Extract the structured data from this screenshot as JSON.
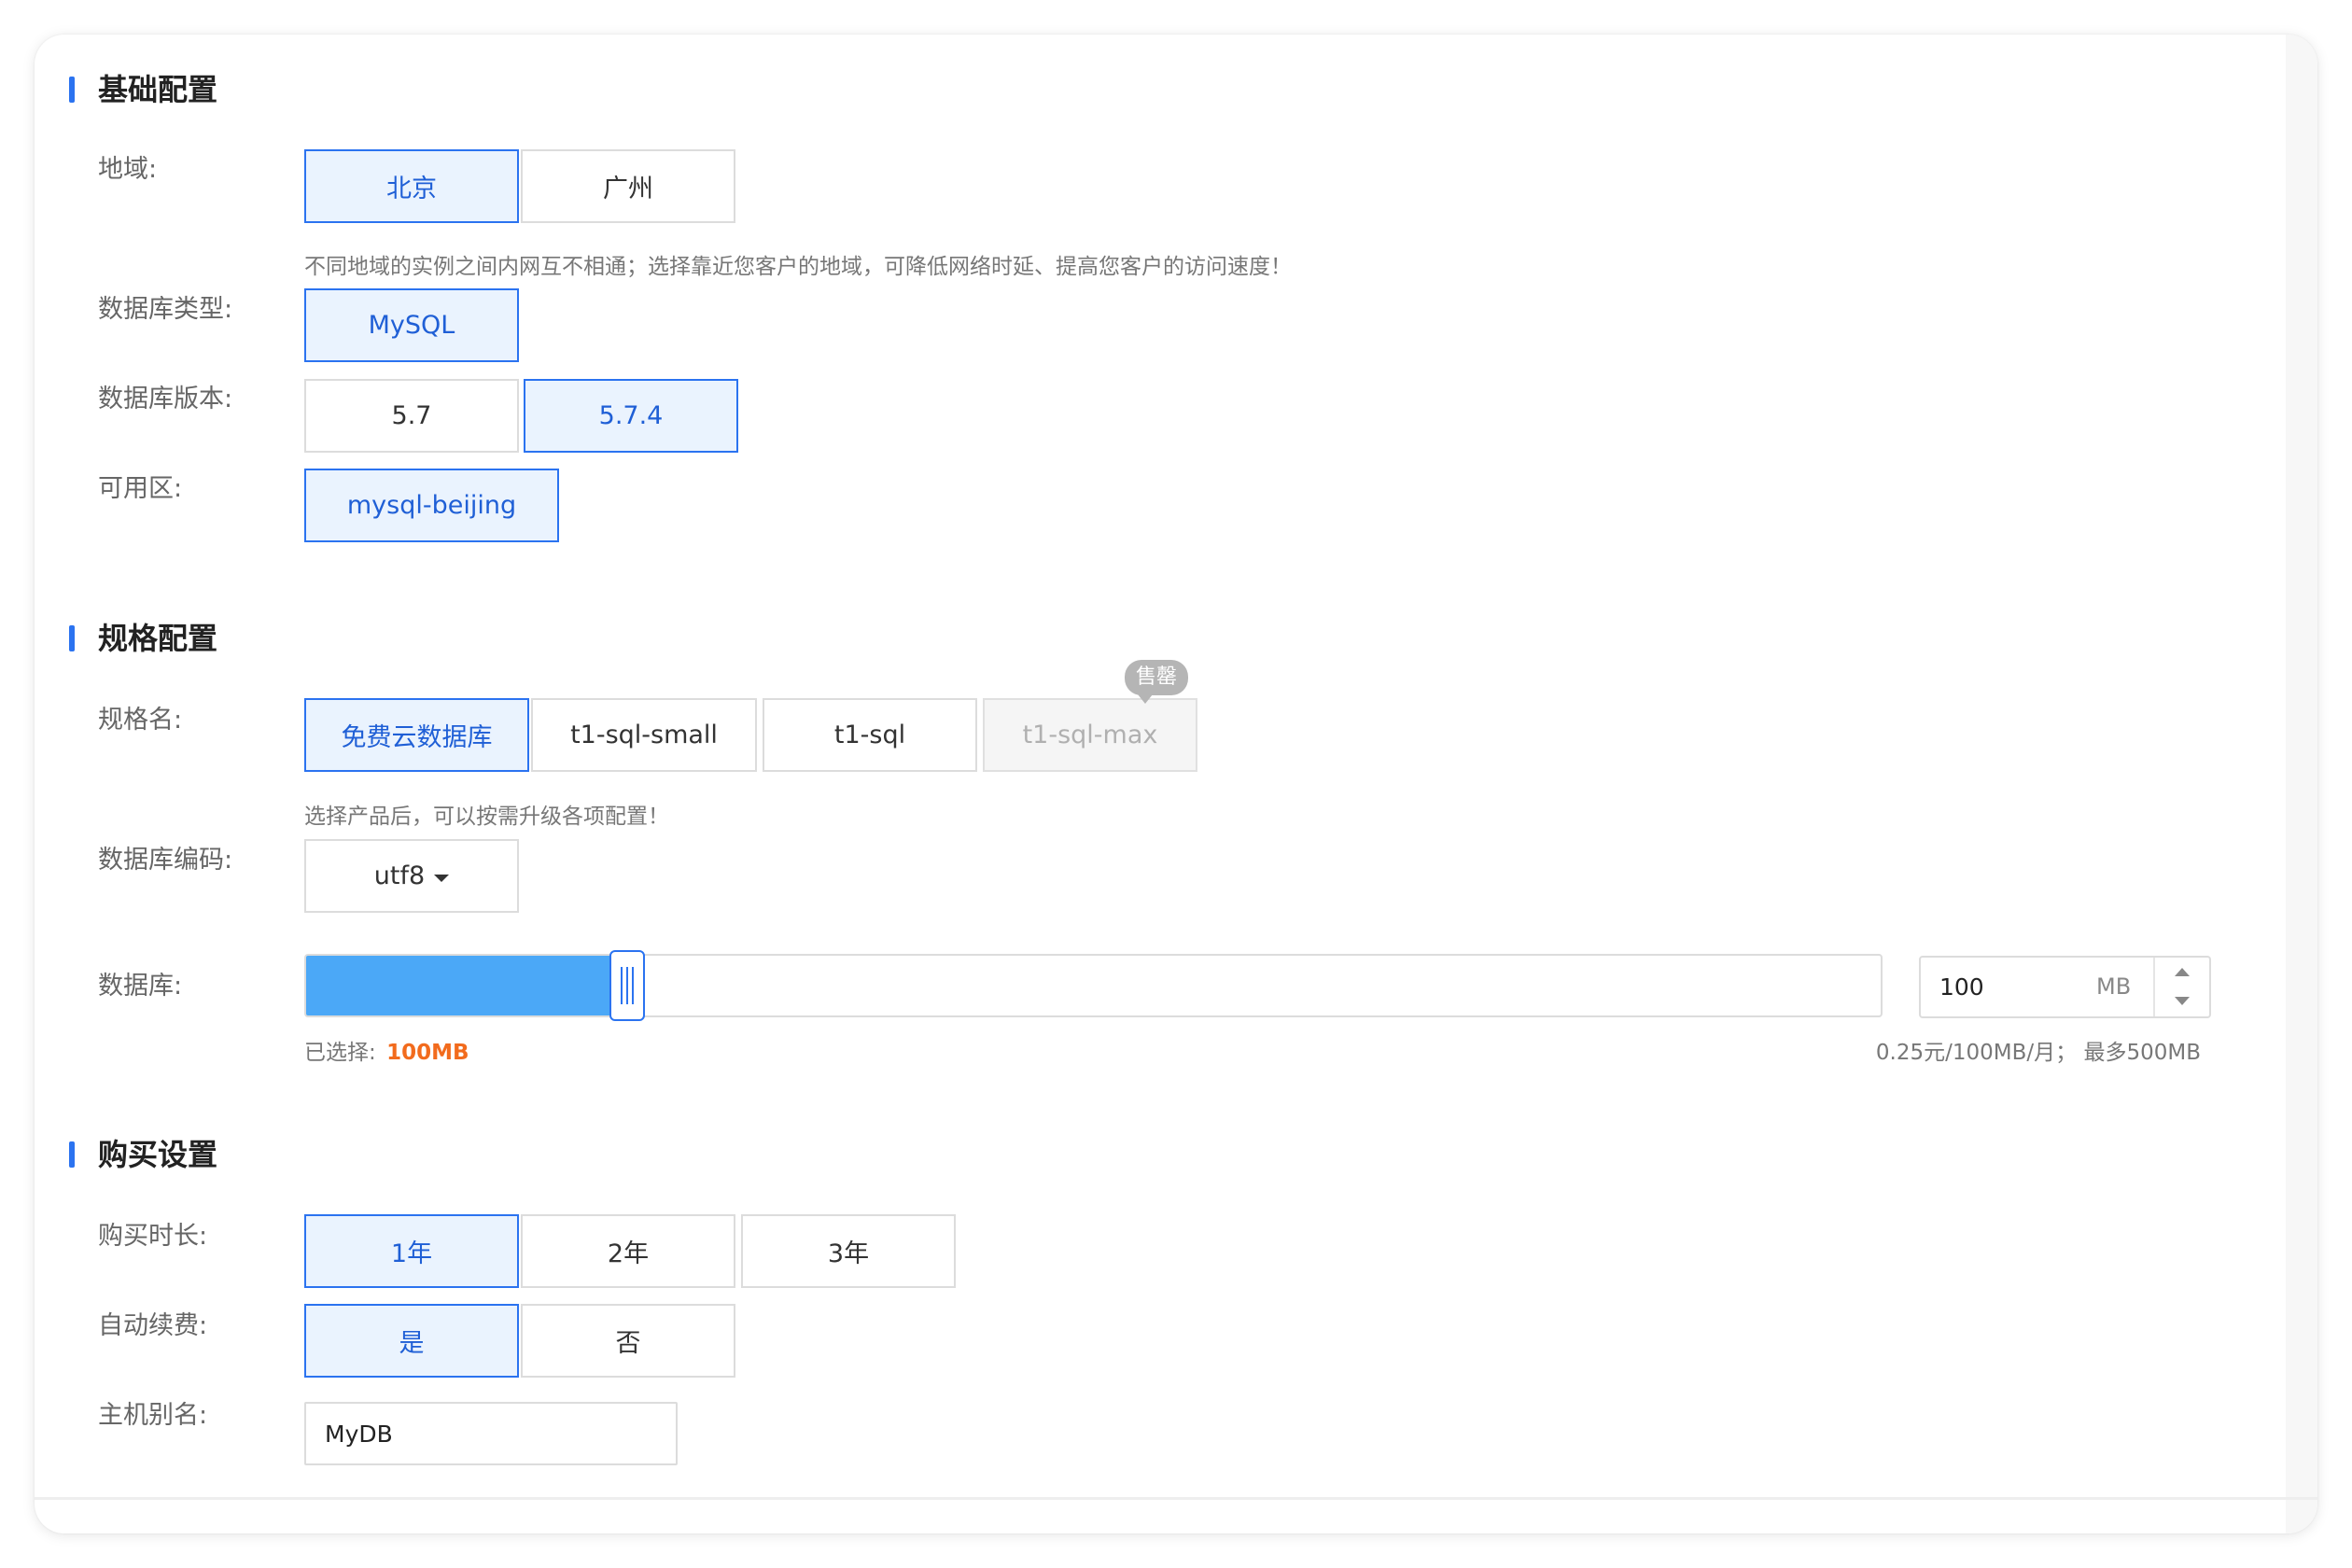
{
  "sections": {
    "basic": "基础配置",
    "spec": "规格配置",
    "purchase": "购买设置"
  },
  "labels": {
    "region": "地域:",
    "db_type": "数据库类型:",
    "db_version": "数据库版本:",
    "zone": "可用区:",
    "spec_name": "规格名:",
    "encoding": "数据库编码:",
    "database": "数据库:",
    "duration": "购买时长:",
    "auto_renew": "自动续费:",
    "host_alias": "主机别名:"
  },
  "region": {
    "options": [
      "北京",
      "广州"
    ],
    "selected": "北京",
    "hint": "不同地域的实例之间内网互不相通；选择靠近您客户的地域，可降低网络时延、提高您客户的访问速度！"
  },
  "db_type": {
    "options": [
      "MySQL"
    ],
    "selected": "MySQL"
  },
  "db_version": {
    "options": [
      "5.7",
      "5.7.4"
    ],
    "selected": "5.7.4"
  },
  "zone": {
    "options": [
      "mysql-beijing"
    ],
    "selected": "mysql-beijing"
  },
  "spec": {
    "options": [
      "免费云数据库",
      "t1-sql-small",
      "t1-sql",
      "t1-sql-max"
    ],
    "selected": "免费云数据库",
    "disabled": "t1-sql-max",
    "soldout_badge": "售罄",
    "hint": "选择产品后，可以按需升级各项配置！"
  },
  "encoding": {
    "value": "utf8",
    "icon": "caret-down-icon"
  },
  "storage": {
    "value": "100",
    "unit": "MB",
    "slider_fraction": 0.2,
    "selected_prefix": "已选择:",
    "selected_value": "100MB",
    "price_note": "0.25元/100MB/月；  最多500MB"
  },
  "duration": {
    "options": [
      "1年",
      "2年",
      "3年"
    ],
    "selected": "1年"
  },
  "auto_renew": {
    "options": [
      "是",
      "否"
    ],
    "selected": "是"
  },
  "host_alias": {
    "value": "MyDB"
  },
  "colors": {
    "accent": "#2b73f0",
    "selected_bg": "#eaf3fe",
    "slider_fill": "#4ba8f7",
    "highlight": "#f26b1d"
  }
}
